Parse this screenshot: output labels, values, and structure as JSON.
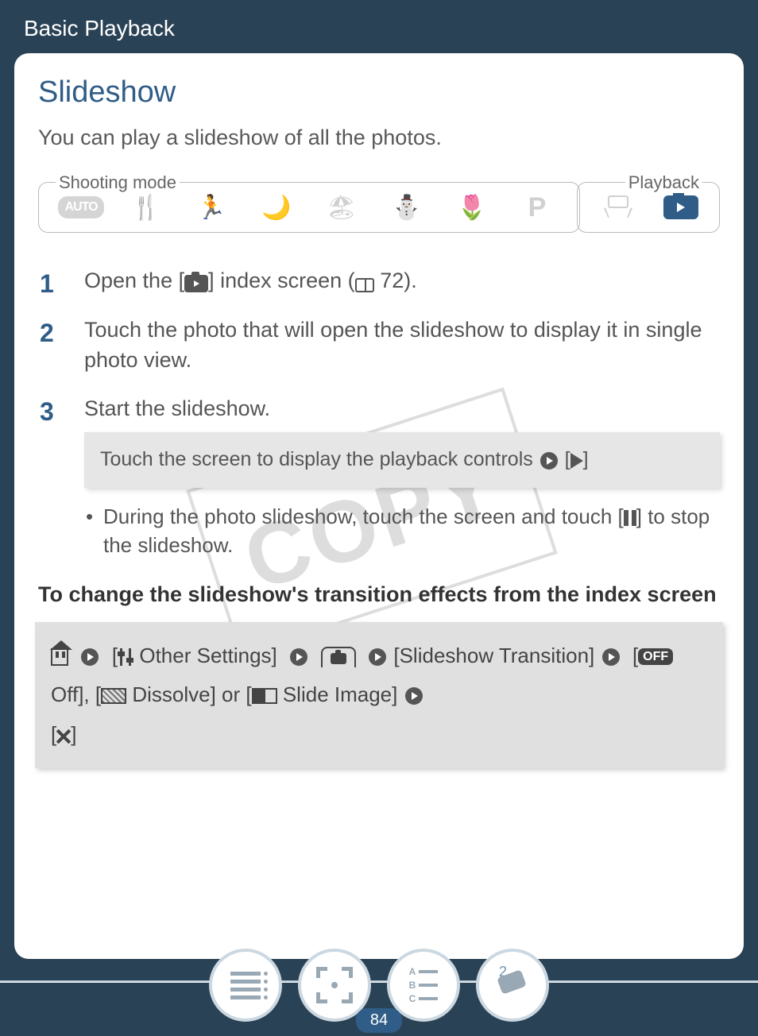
{
  "header": {
    "breadcrumb": "Basic Playback"
  },
  "title": "Slideshow",
  "intro": "You can play a slideshow of all the photos.",
  "modebar": {
    "left_label": "Shooting mode",
    "right_label": "Playback",
    "auto": "AUTO",
    "p": "P"
  },
  "steps": {
    "s1_a": "Open the [",
    "s1_b": "] index screen (",
    "s1_ref": " 72).",
    "s2": "Touch the photo that will open the slideshow to display it in single photo view.",
    "s3": "Start the slideshow.",
    "s3_grey_a": "Touch the screen to display the playback controls ",
    "s3_grey_b": " [",
    "s3_grey_c": "]",
    "s3_bullet_a": "During the photo slideshow, touch the screen and touch [",
    "s3_bullet_b": "] to stop the slideshow."
  },
  "subhead": "To change the slideshow's transition effects from the index screen",
  "transition_block": {
    "other_settings": " Other Settings]",
    "slideshow_transition": " [Slideshow Transition] ",
    "off_label": " Off], [",
    "dissolve_label": " Dissolve] or [",
    "slide_label": " Slide Image] ",
    "opt_off": "OFF"
  },
  "watermark": "COPY",
  "footer": {
    "page_number": "84",
    "cam_count": "2",
    "abc": [
      "A",
      "B",
      "C"
    ]
  }
}
